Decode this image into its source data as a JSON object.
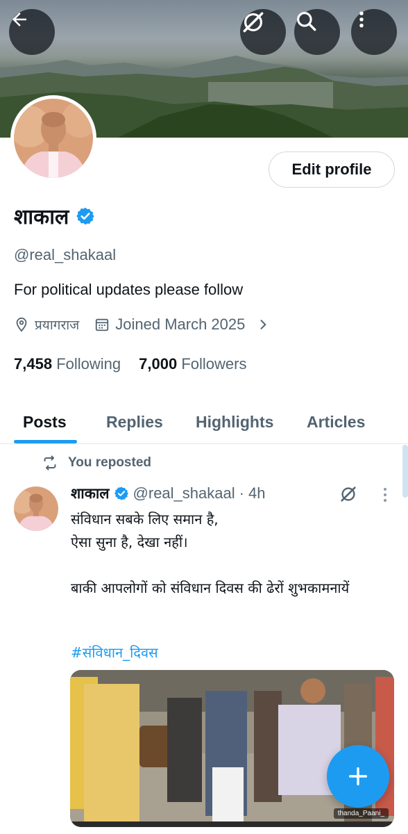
{
  "header": {
    "back_icon": "arrow-left-icon",
    "grok_icon": "grok-slash-icon",
    "search_icon": "search-icon",
    "more_icon": "more-vertical-icon"
  },
  "profile": {
    "display_name": "शाकाल",
    "handle": "@real_shakaal",
    "bio": "For political updates please follow",
    "location": "प्रयागराज",
    "joined": "Joined March 2025",
    "edit_label": "Edit profile",
    "following_count": "7,458",
    "following_label": "Following",
    "followers_count": "7,000",
    "followers_label": "Followers",
    "verified_color": "#1d9bf0"
  },
  "tabs": [
    {
      "label": "Posts"
    },
    {
      "label": "Replies"
    },
    {
      "label": "Highlights"
    },
    {
      "label": "Articles"
    }
  ],
  "post": {
    "repost_label": "You reposted",
    "author_name": "शाकाल",
    "author_handle": "@real_shakaal",
    "separator": "·",
    "time": "4h",
    "text": "संविधान सबके लिए समान है,\nऐसा सुना है, देखा नहीं।\n\nबाकी आपलोगों को संविधान दिवस की ढेरों शुभकामनायें",
    "hashtag": "#संविधान_दिवस",
    "media_watermark": "thanda_Paani_"
  },
  "colors": {
    "accent": "#1d9bf0",
    "text": "#0f1419",
    "muted": "#536471"
  }
}
